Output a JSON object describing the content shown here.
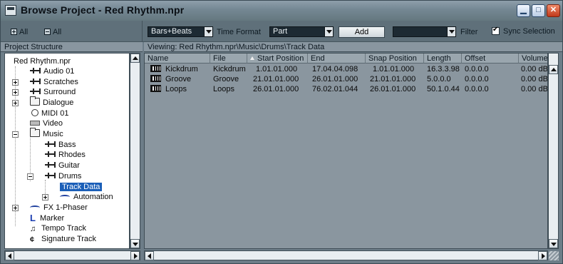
{
  "window": {
    "title": "Browse Project - Red Rhythm.npr",
    "minimize_icon": "minimize-icon",
    "maximize_icon": "maximize-icon",
    "close_icon": "close-icon"
  },
  "toolbar": {
    "expand_all_label": "All",
    "collapse_all_label": "All",
    "time_format_value": "Bars+Beats",
    "time_format_label": "Time Format",
    "type_value": "Part",
    "add_label": "Add",
    "filter_value": "",
    "filter_label": "Filter",
    "sync_label": "Sync Selection",
    "sync_checked": true
  },
  "tree": {
    "header": "Project Structure",
    "root": "Red Rhythm.npr",
    "items": [
      {
        "label": "Audio 01",
        "icon": "audio-track-icon"
      },
      {
        "label": "Scratches",
        "icon": "audio-track-icon"
      },
      {
        "label": "Surround",
        "icon": "audio-track-icon"
      },
      {
        "label": "Dialogue",
        "icon": "folder-icon"
      },
      {
        "label": "MIDI 01",
        "icon": "midi-icon"
      },
      {
        "label": "Video",
        "icon": "video-icon"
      },
      {
        "label": "Music",
        "icon": "folder-icon"
      },
      {
        "label": "Bass",
        "icon": "audio-track-icon"
      },
      {
        "label": "Rhodes",
        "icon": "audio-track-icon"
      },
      {
        "label": "Guitar",
        "icon": "audio-track-icon"
      },
      {
        "label": "Drums",
        "icon": "audio-track-icon"
      },
      {
        "label": "Track Data",
        "icon": ""
      },
      {
        "label": "Automation",
        "icon": "automation-icon"
      },
      {
        "label": "FX 1-Phaser",
        "icon": "fx-icon"
      },
      {
        "label": "Marker",
        "icon": "marker-icon"
      },
      {
        "label": "Tempo Track",
        "icon": "tempo-icon"
      },
      {
        "label": "Signature Track",
        "icon": "signature-icon"
      }
    ],
    "selected": "Track Data"
  },
  "viewing": "Viewing: Red Rhythm.npr\\Music\\Drums\\Track Data",
  "table": {
    "columns": [
      "Name",
      "File",
      "Start Position",
      "End",
      "Snap Position",
      "Length",
      "Offset",
      "Volume"
    ],
    "rows": [
      {
        "name": "Kickdrum",
        "file": "Kickdrum",
        "start": "1.01.01.000",
        "end": "17.04.04.098",
        "snap": "1.01.01.000",
        "length": "16.3.3.98",
        "offset": "0.0.0.0",
        "volume": "0.00 dB"
      },
      {
        "name": "Groove",
        "file": "Groove",
        "start": "21.01.01.000",
        "end": "26.01.01.000",
        "snap": "21.01.01.000",
        "length": "5.0.0.0",
        "offset": "0.0.0.0",
        "volume": "0.00 dB"
      },
      {
        "name": "Loops",
        "file": "Loops",
        "start": "26.01.01.000",
        "end": "76.02.01.044",
        "snap": "26.01.01.000",
        "length": "50.1.0.44",
        "offset": "0.0.0.0",
        "volume": "0.00 dB"
      }
    ]
  },
  "colors": {
    "frame": "#6d7d88",
    "selection": "#1b5fb8",
    "grid_bg": "#8a969f"
  }
}
